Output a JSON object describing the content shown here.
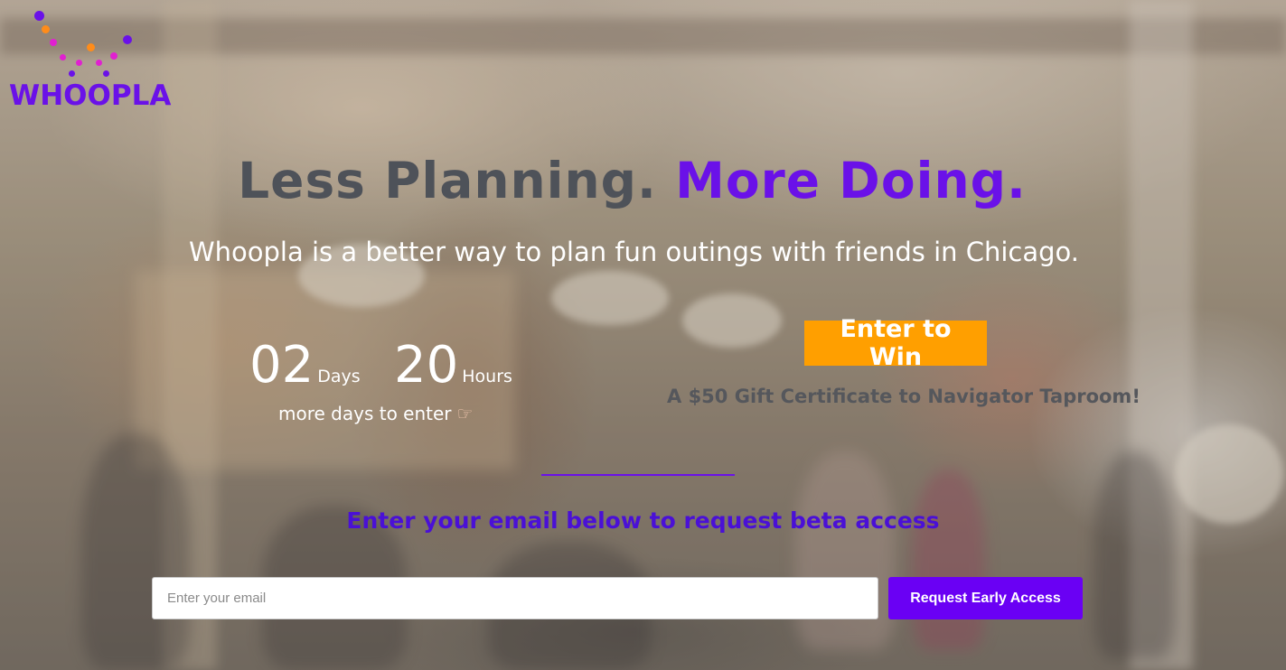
{
  "brand": {
    "name": "WHOOPLA",
    "color_primary": "#6a11e8",
    "color_accent": "#ff9f00"
  },
  "hero": {
    "headline_part1": "Less Planning.",
    "headline_part2": "More Doing.",
    "subhead": "Whoopla is a better way to plan fun outings with friends in Chicago."
  },
  "countdown": {
    "days_value": "02",
    "days_label": "Days",
    "hours_value": "20",
    "hours_label": "Hours",
    "note": "more days to enter",
    "note_icon": "pointing-hand-icon"
  },
  "contest": {
    "button_label": "Enter to Win",
    "prize_text": "A $50 Gift Certificate to Navigator Taproom!"
  },
  "signup": {
    "prompt": "Enter your email below to request beta access",
    "email_placeholder": "Enter your email",
    "email_value": "",
    "submit_label": "Request Early Access"
  }
}
